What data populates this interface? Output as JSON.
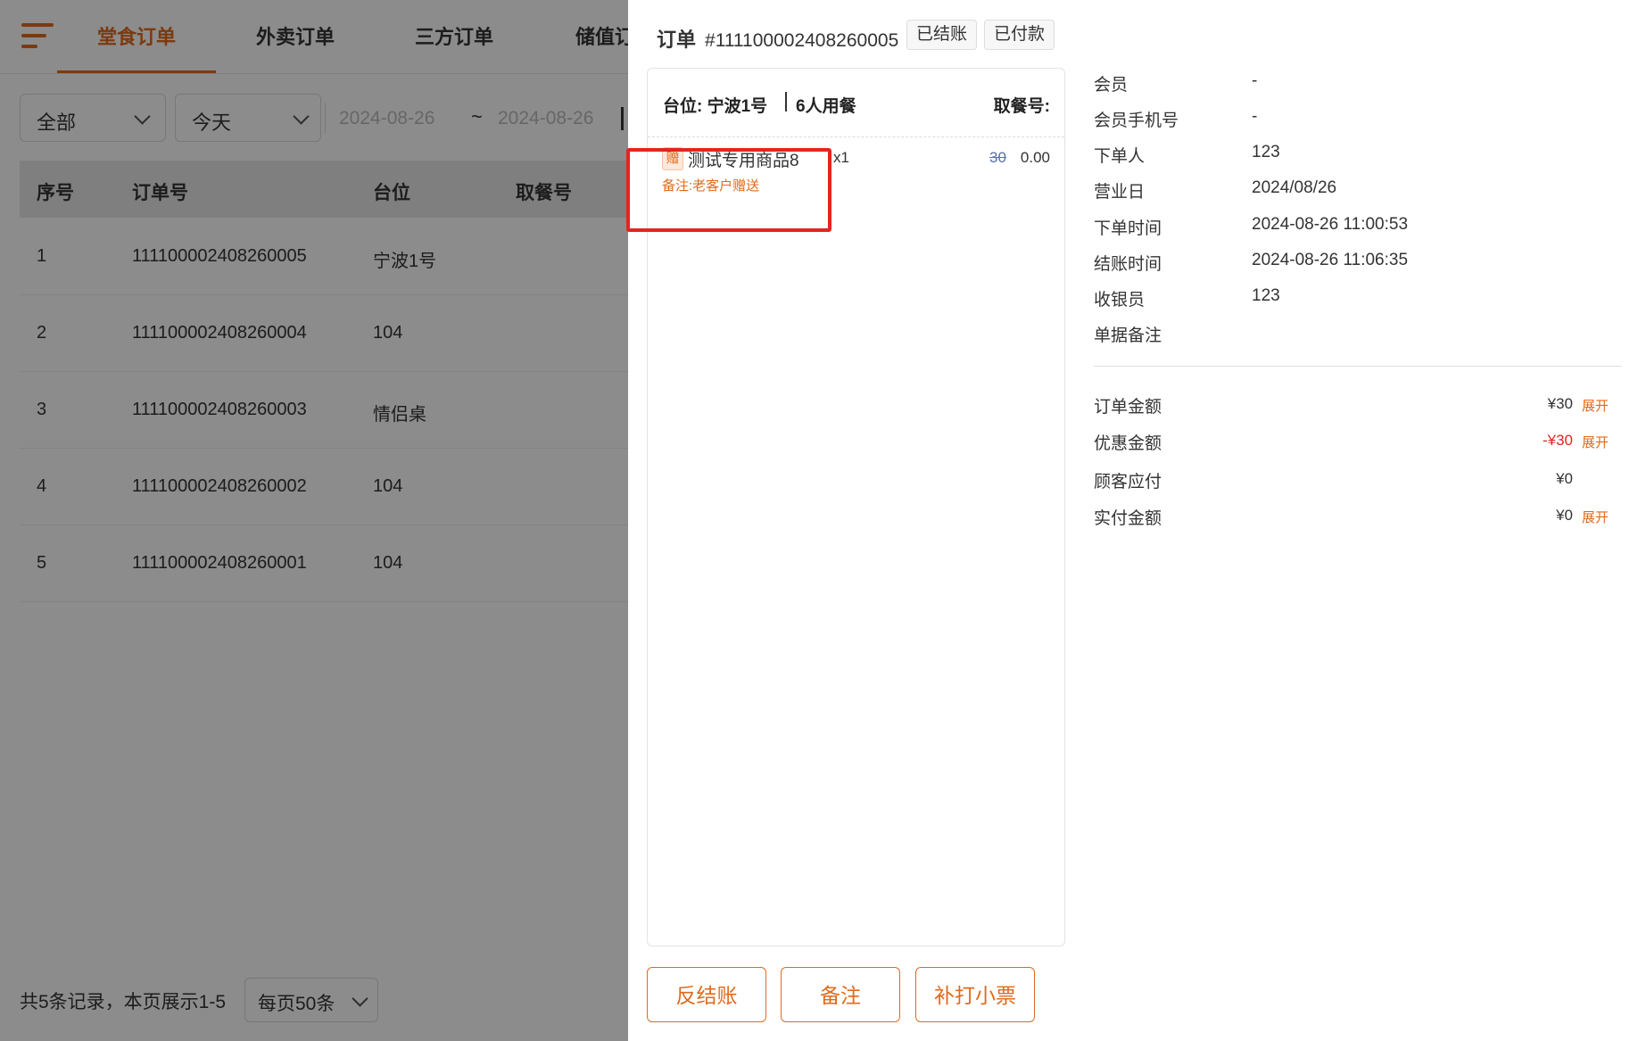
{
  "tabs": [
    {
      "label": "堂食订单",
      "active": true
    },
    {
      "label": "外卖订单",
      "active": false
    },
    {
      "label": "三方订单",
      "active": false
    },
    {
      "label": "储值订",
      "active": false
    }
  ],
  "filters": {
    "status_value": "全部",
    "range_value": "今天",
    "date_start": "2024-08-26",
    "date_sep": "~",
    "date_end": "2024-08-26"
  },
  "table": {
    "headers": [
      "序号",
      "订单号",
      "台位",
      "取餐号"
    ],
    "rows": [
      [
        "1",
        "111100002408260005",
        "宁波1号",
        ""
      ],
      [
        "2",
        "111100002408260004",
        "104",
        ""
      ],
      [
        "3",
        "111100002408260003",
        "情侣桌",
        ""
      ],
      [
        "4",
        "111100002408260002",
        "104",
        ""
      ],
      [
        "5",
        "111100002408260001",
        "104",
        ""
      ]
    ]
  },
  "pager": {
    "summary": "共5条记录，本页展示1-5",
    "page_size": "每页50条"
  },
  "drawer": {
    "title_label": "订单",
    "order_no": "#111100002408260005",
    "tags": [
      "已结账",
      "已付款"
    ],
    "seat": "台位: 宁波1号",
    "people": "6人用餐",
    "pickup": "取餐号:",
    "items": [
      {
        "badge": "赠",
        "name": "测试专用商品8",
        "note": "备注:老客户赠送",
        "qty": "x1",
        "original_price": "30",
        "price": "0.00"
      }
    ],
    "info": [
      {
        "label": "会员",
        "value": "-"
      },
      {
        "label": "会员手机号",
        "value": "-"
      },
      {
        "label": "下单人",
        "value": "123"
      },
      {
        "label": "营业日",
        "value": "2024/08/26"
      },
      {
        "label": "下单时间",
        "value": "2024-08-26 11:00:53"
      },
      {
        "label": "结账时间",
        "value": "2024-08-26 11:06:35"
      },
      {
        "label": "收银员",
        "value": "123"
      },
      {
        "label": "单据备注",
        "value": ""
      }
    ],
    "amounts": [
      {
        "label": "订单金额",
        "value": "¥30",
        "expand": "展开"
      },
      {
        "label": "优惠金额",
        "value": "-¥30",
        "expand": "展开"
      },
      {
        "label": "顾客应付",
        "value": "¥0",
        "expand": ""
      },
      {
        "label": "实付金额",
        "value": "¥0",
        "expand": "展开"
      }
    ],
    "buttons": [
      "反结账",
      "备注",
      "补打小票"
    ]
  },
  "colors": {
    "accent": "#e06a1c",
    "highlight": "#e3251f",
    "discount": "#e3251f"
  }
}
